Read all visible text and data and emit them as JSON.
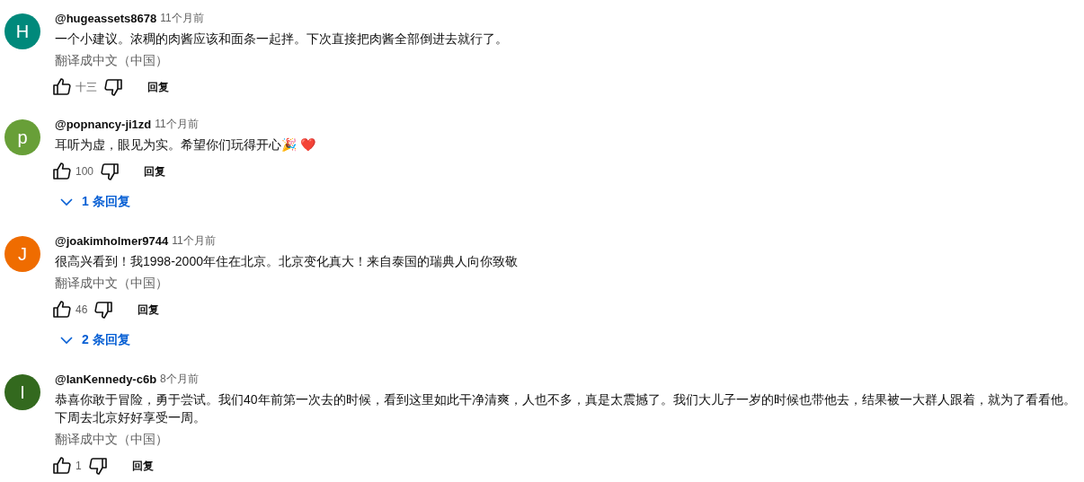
{
  "comments": [
    {
      "avatar": {
        "letter": "H",
        "color": "#00897b"
      },
      "author": "@hugeassets8678",
      "time": "11个月前",
      "text": "一个小建议。浓稠的肉酱应该和面条一起拌。下次直接把肉酱全部倒进去就行了。",
      "translate": "翻译成中文（中国）",
      "likes": "十三",
      "reply": "回复"
    },
    {
      "avatar": {
        "letter": "p",
        "color": "#689f38"
      },
      "author": "@popnancy-ji1zd",
      "time": "11个月前",
      "text": "耳听为虚，眼见为实。希望你们玩得开心🎉 ❤️",
      "likes": "100",
      "reply": "回复",
      "replies_toggle": "1 条回复"
    },
    {
      "avatar": {
        "letter": "J",
        "color": "#ef6c00"
      },
      "author": "@joakimholmer9744",
      "time": "11个月前",
      "text": "很高兴看到！我1998-2000年住在北京。北京变化真大！来自泰国的瑞典人向你致敬",
      "translate": "翻译成中文（中国）",
      "likes": "46",
      "reply": "回复",
      "replies_toggle": "2 条回复"
    },
    {
      "avatar": {
        "letter": "I",
        "color": "#33691e"
      },
      "author": "@IanKennedy-c6b",
      "time": "8个月前",
      "text": "恭喜你敢于冒险，勇于尝试。我们40年前第一次去的时候，看到这里如此干净清爽，人也不多，真是太震撼了。我们大儿子一岁的时候也带他去，结果被一大群人跟着，就为了看看他。下周去北京好好享受一周。",
      "translate": "翻译成中文（中国）",
      "likes": "1",
      "reply": "回复"
    }
  ]
}
